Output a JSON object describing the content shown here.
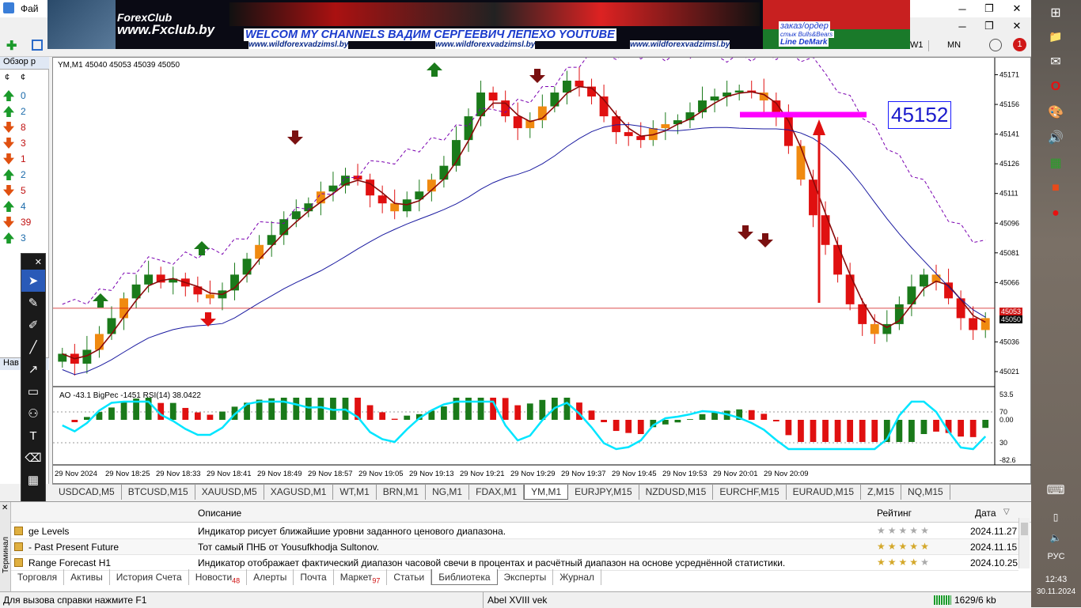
{
  "titlebar": {
    "file_menu": "Фай"
  },
  "banner": {
    "logo": "ForexClub",
    "site": "www.Fxclub.by",
    "headline": "WELCOM MY CHANNELS ВАДИМ СЕРГЕЕВИЧ ЛЕПЕХО YOUTUBE",
    "urls": [
      "www.wildforexvadzimsl.by",
      "www.wildforexvadzimsl.by",
      "www.wildforexvadzimsl.by"
    ],
    "right_line1": "заказ/ордер",
    "right_line2": "стык Bulls&Bears",
    "right_line3": "Line DeMark"
  },
  "toolbar": {
    "periods": [
      "W1",
      "MN"
    ],
    "notifications_badge": "1"
  },
  "market_watch": {
    "title": "Обзор р",
    "rows": [
      {
        "value": "0",
        "dir": "up"
      },
      {
        "value": "2",
        "dir": "up"
      },
      {
        "value": "8",
        "dir": "down"
      },
      {
        "value": "3",
        "dir": "down"
      },
      {
        "value": "1",
        "dir": "down"
      },
      {
        "value": "2",
        "dir": "up"
      },
      {
        "value": "5",
        "dir": "down"
      },
      {
        "value": "4",
        "dir": "up"
      },
      {
        "value": "39",
        "dir": "down"
      },
      {
        "value": "3",
        "dir": "up"
      }
    ],
    "nav_title": "Нав"
  },
  "chart": {
    "header": "YM,M1  45040 45053 45039 45050",
    "target_label": "45152",
    "current_price": "45050",
    "bid_price": "45053",
    "indicator_header": "AO -43.1  BigPec -1451  RSI(14) 38.0422"
  },
  "chart_data": {
    "type": "candlestick",
    "symbol": "YM,M1",
    "price_axis": [
      "45171",
      "45156",
      "45141",
      "45126",
      "45111",
      "45096",
      "45081",
      "45066",
      "45036",
      "45021"
    ],
    "time_axis": [
      "29 Nov 2024",
      "29 Nov 18:25",
      "29 Nov 18:33",
      "29 Nov 18:41",
      "29 Nov 18:49",
      "29 Nov 18:57",
      "29 Nov 19:05",
      "29 Nov 19:13",
      "29 Nov 19:21",
      "29 Nov 19:29",
      "29 Nov 19:37",
      "29 Nov 19:45",
      "29 Nov 19:53",
      "29 Nov 20:01",
      "29 Nov 20:09"
    ],
    "indicator_axis": [
      "53.5",
      "70",
      "0.00",
      "30",
      "-82.6"
    ],
    "close_path": [
      45030,
      45025,
      45032,
      45040,
      45048,
      45058,
      45065,
      45070,
      45066,
      45068,
      45064,
      45060,
      45058,
      45062,
      45070,
      45078,
      45085,
      45090,
      45098,
      45102,
      45106,
      45112,
      45115,
      45120,
      45118,
      45110,
      45106,
      45102,
      45108,
      45112,
      45118,
      45125,
      45138,
      45150,
      45162,
      45158,
      45150,
      45144,
      45148,
      45155,
      45162,
      45168,
      45165,
      45160,
      45150,
      45142,
      45140,
      45138,
      45144,
      45146,
      45148,
      45152,
      45158,
      45160,
      45162,
      45163,
      45162,
      45158,
      45150,
      45135,
      45118,
      45100,
      45085,
      45070,
      45055,
      45045,
      45040,
      45045,
      45055,
      45064,
      45070,
      45066,
      45058,
      45048,
      45042,
      45048
    ]
  },
  "symbol_tabs": [
    "USDCAD,M5",
    "BTCUSD,M15",
    "XAUUSD,M5",
    "XAGUSD,M1",
    "WT,M1",
    "BRN,M1",
    "NG,M1",
    "FDAX,M1",
    "YM,M1",
    "EURJPY,M15",
    "NZDUSD,M15",
    "EURCHF,M15",
    "EURAUD,M15",
    "Z,M15",
    "NQ,M15"
  ],
  "active_symbol_tab": "YM,M1",
  "terminal": {
    "headers": {
      "name": "",
      "description": "Описание",
      "rating": "Рейтинг",
      "date": "Дата"
    },
    "rows": [
      {
        "name": "ge Levels",
        "description": "Индикатор рисует ближайшие уровни заданного ценового диапазона.",
        "rating": 0,
        "date": "2024.11.27"
      },
      {
        "name": "- Past Present Future",
        "description": "Тот самый ПНБ от Yousufkhodja Sultonov.",
        "rating": 5,
        "date": "2024.11.15"
      },
      {
        "name": "Range Forecast H1",
        "description": "Индикатор отображает фактический диапазон часовой свечи в процентах и расчётный диапазон на основе усреднённой статистики.",
        "rating": 4,
        "date": "2024.10.25"
      }
    ],
    "tabs": [
      {
        "label": "Торговля",
        "badge": ""
      },
      {
        "label": "Активы",
        "badge": ""
      },
      {
        "label": "История Счета",
        "badge": ""
      },
      {
        "label": "Новости",
        "badge": "48"
      },
      {
        "label": "Алерты",
        "badge": ""
      },
      {
        "label": "Почта",
        "badge": ""
      },
      {
        "label": "Маркет",
        "badge": "97"
      },
      {
        "label": "Статьи",
        "badge": ""
      },
      {
        "label": "Библиотека",
        "badge": ""
      },
      {
        "label": "Эксперты",
        "badge": ""
      },
      {
        "label": "Журнал",
        "badge": ""
      }
    ],
    "active_tab": "Библиотека",
    "side_label": "Терминал"
  },
  "status": {
    "help": "Для вызова справки нажмите F1",
    "profile": "Abel XVIII vek",
    "traffic": "1629/6 kb"
  },
  "taskbar": {
    "lang": "РУС",
    "time": "12:43",
    "date": "30.11.2024"
  },
  "colors": {
    "bull": "#1a7a1a",
    "bear": "#e01010",
    "magenta": "#ff00ff",
    "target_line": "#ff0000"
  }
}
